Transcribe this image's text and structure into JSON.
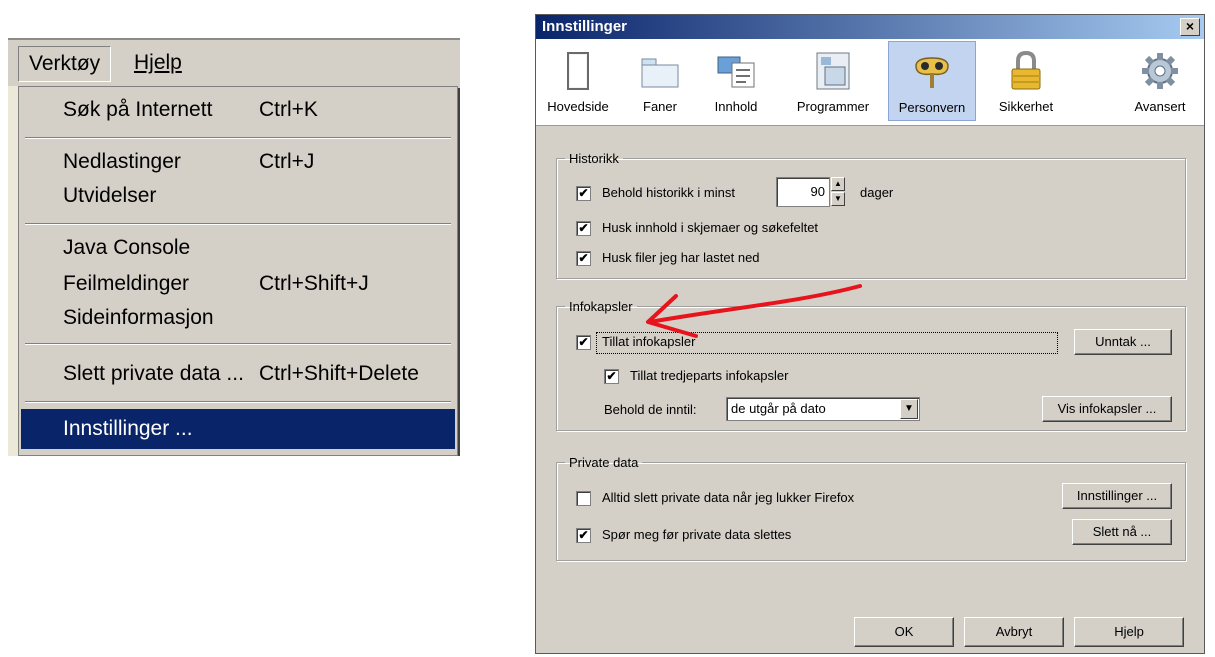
{
  "menu": {
    "menubar": {
      "tools": "Verktøy",
      "help": "Hjelp"
    },
    "items": [
      {
        "label": "Søk på Internett",
        "shortcut": "Ctrl+K"
      },
      {
        "label": "Nedlastinger",
        "shortcut": "Ctrl+J"
      },
      {
        "label": "Utvidelser",
        "shortcut": ""
      },
      {
        "label": "Java Console",
        "shortcut": ""
      },
      {
        "label": "Feilmeldinger",
        "shortcut": "Ctrl+Shift+J"
      },
      {
        "label": "Sideinformasjon",
        "shortcut": ""
      },
      {
        "label": "Slett private data ...",
        "shortcut": "Ctrl+Shift+Delete"
      },
      {
        "label": "Innstillinger ...",
        "shortcut": ""
      }
    ],
    "selected_item": "Innstillinger ..."
  },
  "dialog": {
    "title": "Innstillinger",
    "close_glyph": "×",
    "tabs": [
      {
        "label": "Hovedside",
        "icon": "window-icon"
      },
      {
        "label": "Faner",
        "icon": "tabs-icon"
      },
      {
        "label": "Innhold",
        "icon": "content-icon"
      },
      {
        "label": "Programmer",
        "icon": "applications-icon"
      },
      {
        "label": "Personvern",
        "icon": "privacy-mask-icon"
      },
      {
        "label": "Sikkerhet",
        "icon": "padlock-icon"
      },
      {
        "label": "Avansert",
        "icon": "gear-icon"
      }
    ],
    "active_tab": "Personvern",
    "history": {
      "legend": "Historikk",
      "keep_history_label": "Behold historikk i minst",
      "keep_history_checked": true,
      "days_value": "90",
      "days_unit": "dager",
      "remember_forms_label": "Husk innhold i skjemaer og søkefeltet",
      "remember_forms_checked": true,
      "remember_downloads_label": "Husk filer jeg har lastet ned",
      "remember_downloads_checked": true
    },
    "cookies": {
      "legend": "Infokapsler",
      "allow_cookies_label": "Tillat infokapsler",
      "allow_cookies_checked": true,
      "allow_third_party_label": "Tillat tredjeparts infokapsler",
      "allow_third_party_checked": true,
      "keep_until_label": "Behold de inntil:",
      "keep_until_value": "de utgår på dato",
      "exceptions_button": "Unntak ...",
      "show_cookies_button": "Vis infokapsler ..."
    },
    "private_data": {
      "legend": "Private data",
      "always_clear_label": "Alltid slett private data når jeg lukker Firefox",
      "always_clear_checked": false,
      "ask_before_label": "Spør meg før private data slettes",
      "ask_before_checked": true,
      "settings_button": "Innstillinger ...",
      "clear_now_button": "Slett nå ..."
    },
    "footer": {
      "ok": "OK",
      "cancel": "Avbryt",
      "help": "Hjelp"
    },
    "check_glyph": "✔",
    "arrow_up": "▲",
    "arrow_down": "▼",
    "annotation_color": "#e8141c"
  }
}
